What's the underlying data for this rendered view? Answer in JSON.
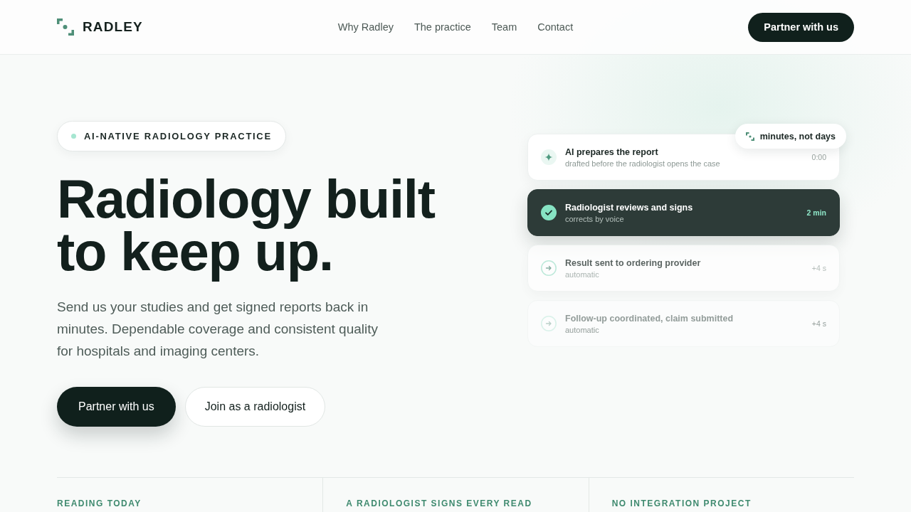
{
  "header": {
    "logo": "RADLEY",
    "nav": [
      "Why Radley",
      "The practice",
      "Team",
      "Contact"
    ],
    "cta": "Partner with us"
  },
  "hero": {
    "badge": "AI-NATIVE RADIOLOGY PRACTICE",
    "title": "Radiology built to keep up.",
    "lead": "Send us your studies and get signed reports back in minutes. Dependable coverage and consistent quality for hospitals and imaging centers.",
    "buttons": [
      {
        "label": "Partner with us",
        "kind": "primary"
      },
      {
        "label": "Join as a radiologist",
        "kind": "secondary"
      }
    ]
  },
  "workflow": {
    "tag": "minutes, not days",
    "steps": [
      {
        "title": "AI prepares the report",
        "detail": "drafted before the radiologist opens the case",
        "time": "0:00",
        "kind": "sparkle",
        "selected": false,
        "faded": false,
        "disabled": false
      },
      {
        "title": "Radiologist reviews and signs",
        "detail": "corrects by voice",
        "time": "2 min",
        "kind": "check",
        "selected": true,
        "faded": false,
        "disabled": false
      },
      {
        "title": "Result sent to ordering provider",
        "detail": "automatic",
        "time": "+4 s",
        "kind": "arrow",
        "selected": false,
        "faded": true,
        "disabled": false
      },
      {
        "title": "Follow-up coordinated, claim submitted",
        "detail": "automatic",
        "time": "+4 s",
        "kind": "arrow",
        "selected": false,
        "faded": false,
        "disabled": true
      }
    ]
  },
  "stats": [
    {
      "label": "READING TODAY"
    },
    {
      "label": "A RADIOLOGIST SIGNS EVERY READ"
    },
    {
      "label": "NO INTEGRATION PROJECT"
    }
  ]
}
